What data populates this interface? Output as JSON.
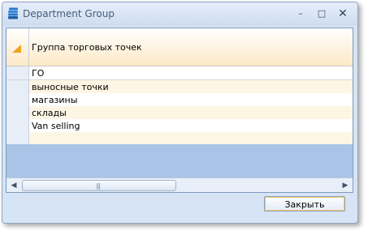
{
  "window": {
    "title": "Department Group",
    "buttons": {
      "minimize": "–",
      "maximize": "□",
      "close": "✕"
    }
  },
  "grid": {
    "column_header": "Группа торговых точек",
    "rows": [
      "ГО",
      "выносные точки",
      "магазины",
      "склады",
      "Van selling",
      ""
    ]
  },
  "scrollbar": {
    "grip": "|||"
  },
  "footer": {
    "close_label": "Закрыть"
  },
  "colors": {
    "header_accent": "#f0a51e",
    "grid_empty": "#a9c4e6",
    "alt_row": "#fdf6e4"
  }
}
